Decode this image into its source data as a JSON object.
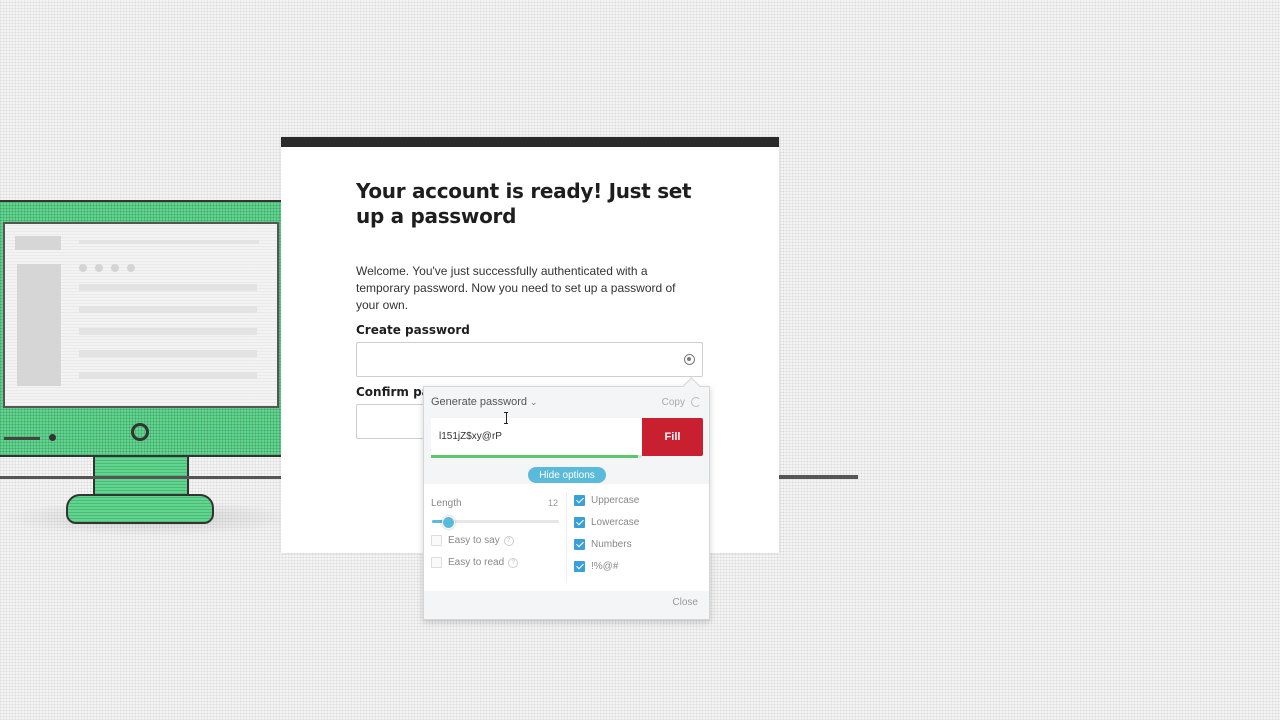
{
  "page": {
    "title": "Your account is ready! Just set up a password",
    "intro": "Welcome. You've just successfully authenticated with a temporary password. Now you need to set up a password of your own.",
    "create_label": "Create password",
    "confirm_label": "Confirm pas"
  },
  "generator": {
    "header": "Generate password",
    "copy": "Copy",
    "password": "l151jZ$xy@rP",
    "strength": 0.98,
    "fill": "Fill",
    "hide_options": "Hide options",
    "length_label": "Length",
    "length_value": "12",
    "length_level": 0.12,
    "easy_to_say": "Easy to say",
    "easy_to_read": "Easy to read",
    "uppercase": "Uppercase",
    "lowercase": "Lowercase",
    "numbers": "Numbers",
    "symbols": "!%@#",
    "close": "Close"
  },
  "colors": {
    "fill_button": "#c8202f",
    "accent": "#5bbad9",
    "strength": "#5cc66d",
    "monitor": "#5fd68e"
  }
}
